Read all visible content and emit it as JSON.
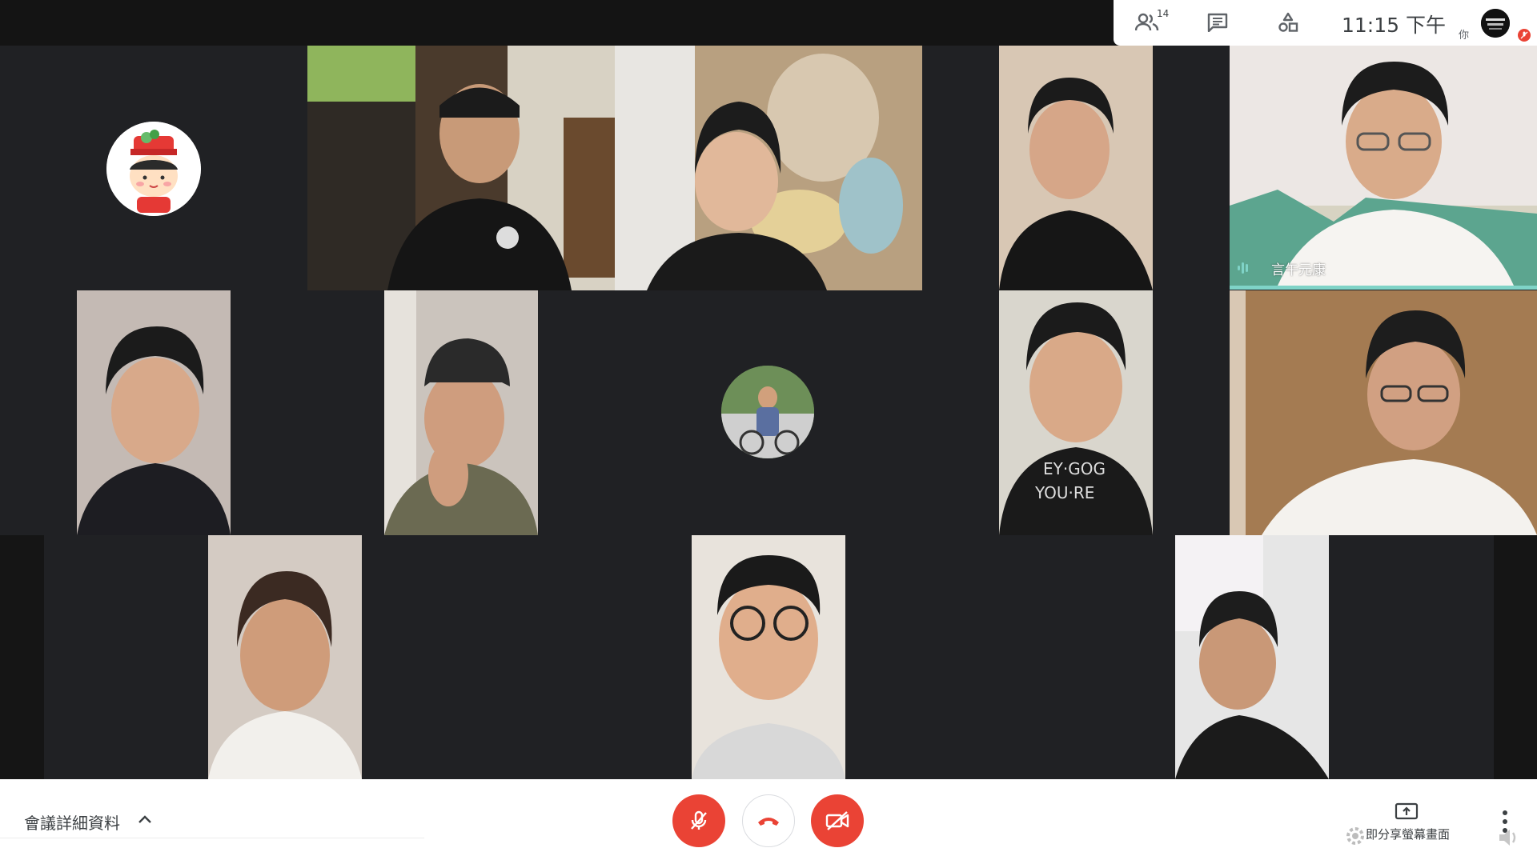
{
  "topbar": {
    "participants_count": "14",
    "time": "11:15 下午",
    "you_label": "你",
    "icons": [
      "people-icon",
      "chat-icon",
      "activities-icon"
    ]
  },
  "tiles": {
    "speaker_name": "言午元康"
  },
  "bottombar": {
    "meeting_details_label": "會議詳細資料",
    "present_label": "即分享螢幕畫面"
  },
  "colors": {
    "accent_red": "#ea4335",
    "speaking_teal": "#7fd3c7",
    "grid_bg": "#202124"
  }
}
